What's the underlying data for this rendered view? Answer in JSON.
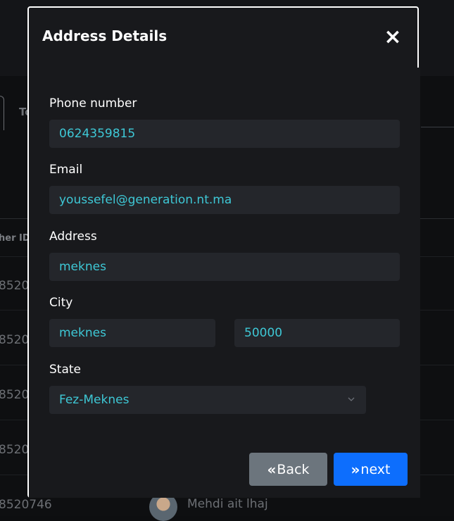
{
  "background": {
    "tab_label": "To",
    "column_header": "her ID",
    "rows": [
      "8520",
      "8520",
      "8520",
      "8520",
      "8520746"
    ],
    "last_row_name": "Mehdi ait lhaj"
  },
  "modal": {
    "title": "Address Details",
    "close_icon": "×",
    "fields": {
      "phone_label": "Phone number",
      "phone_value": "0624359815",
      "email_label": "Email",
      "email_value": "youssefel@generation.nt.ma",
      "address_label": "Address",
      "address_value": "meknes",
      "city_label": "City",
      "city_value": "meknes",
      "postal_value": "50000",
      "state_label": "State",
      "state_value": "Fez-Meknes"
    },
    "buttons": {
      "back_label": "Back",
      "back_icon": "«",
      "next_label": "next",
      "next_icon": "»"
    }
  },
  "colors": {
    "input_text": "#3ec8d6",
    "primary": "#0d6efd",
    "secondary": "#6c757d"
  }
}
